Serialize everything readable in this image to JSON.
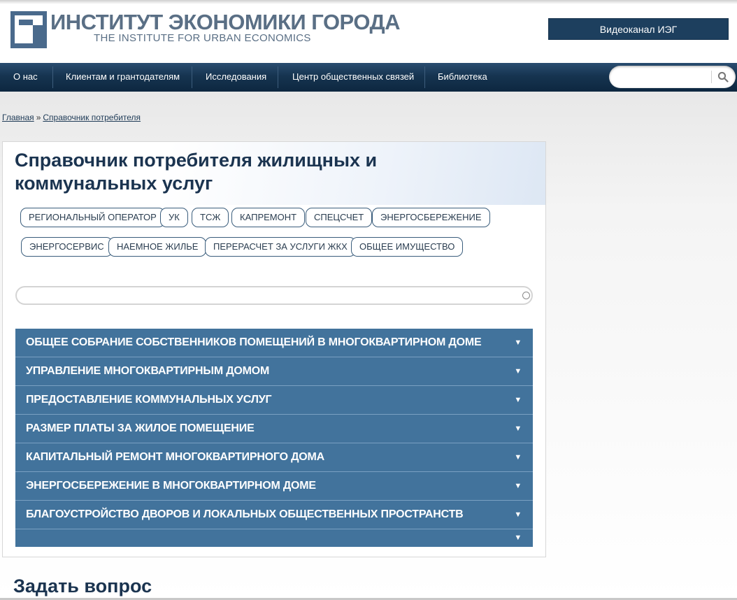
{
  "header": {
    "logo_title": "ИНСТИТУТ ЭКОНОМИКИ ГОРОДА",
    "logo_subtitle": "THE INSTITUTE FOR URBAN ECONOMICS",
    "video_button": "Видеоканал ИЭГ"
  },
  "nav": {
    "items": [
      {
        "label": "О нас"
      },
      {
        "label": "Клиентам и грантодателям"
      },
      {
        "label": "Исследования"
      },
      {
        "label": "Центр общественных связей"
      },
      {
        "label": "Библиотека"
      }
    ],
    "search_value": "",
    "search_icon": "search-icon"
  },
  "breadcrumb": {
    "home": "Главная",
    "separator": "»",
    "current": "Справочник потребителя"
  },
  "main": {
    "title": "Справочник потребителя жилищных и коммунальных услуг",
    "tags": [
      {
        "label": "РЕГИОНАЛЬНЫЙ ОПЕРАТОР"
      },
      {
        "label": "УК"
      },
      {
        "label": "ТСЖ"
      },
      {
        "label": "КАПРЕМОНТ"
      },
      {
        "label": "СПЕЦСЧЕТ"
      },
      {
        "label": "ЭНЕРГОСБЕРЕЖЕНИЕ"
      },
      {
        "label": "ЭНЕРГОСЕРВИС"
      },
      {
        "label": "НАЕМНОЕ ЖИЛЬЕ"
      },
      {
        "label": "ПЕРЕРАСЧЕТ ЗА УСЛУГИ ЖКХ"
      },
      {
        "label": "ОБЩЕЕ ИМУЩЕСТВО"
      }
    ],
    "filter_value": "",
    "sections": [
      {
        "label": "ОБЩЕЕ СОБРАНИЕ СОБСТВЕННИКОВ ПОМЕЩЕНИЙ В МНОГОКВАРТИРНОМ ДОМЕ",
        "arrow": "▼"
      },
      {
        "label": "УПРАВЛЕНИЕ МНОГОКВАРТИРНЫМ ДОМОМ",
        "arrow": "▼"
      },
      {
        "label": "ПРЕДОСТАВЛЕНИЕ КОММУНАЛЬНЫХ УСЛУГ",
        "arrow": "▼"
      },
      {
        "label": "РАЗМЕР ПЛАТЫ ЗА ЖИЛОЕ ПОМЕЩЕНИЕ",
        "arrow": "▼"
      },
      {
        "label": "КАПИТАЛЬНЫЙ РЕМОНТ МНОГОКВАРТИРНОГО ДОМА",
        "arrow": "▼"
      },
      {
        "label": "ЭНЕРГОСБЕРЕЖЕНИЕ В МНОГОКВАРТИРНОМ ДОМЕ",
        "arrow": "▼"
      },
      {
        "label": "БЛАГОУСТРОЙСТВО ДВОРОВ И ЛОКАЛЬНЫХ ОБЩЕСТВЕННЫХ ПРОСТРАНСТВ",
        "arrow": "▼"
      },
      {
        "label": "",
        "arrow": "▼"
      }
    ]
  },
  "ask": {
    "title": "Задать вопрос"
  },
  "colors": {
    "nav_bg": "#163450",
    "accordion_bg": "#42739c",
    "title_color": "#1b3450",
    "logo_color": "#5a6f85"
  }
}
